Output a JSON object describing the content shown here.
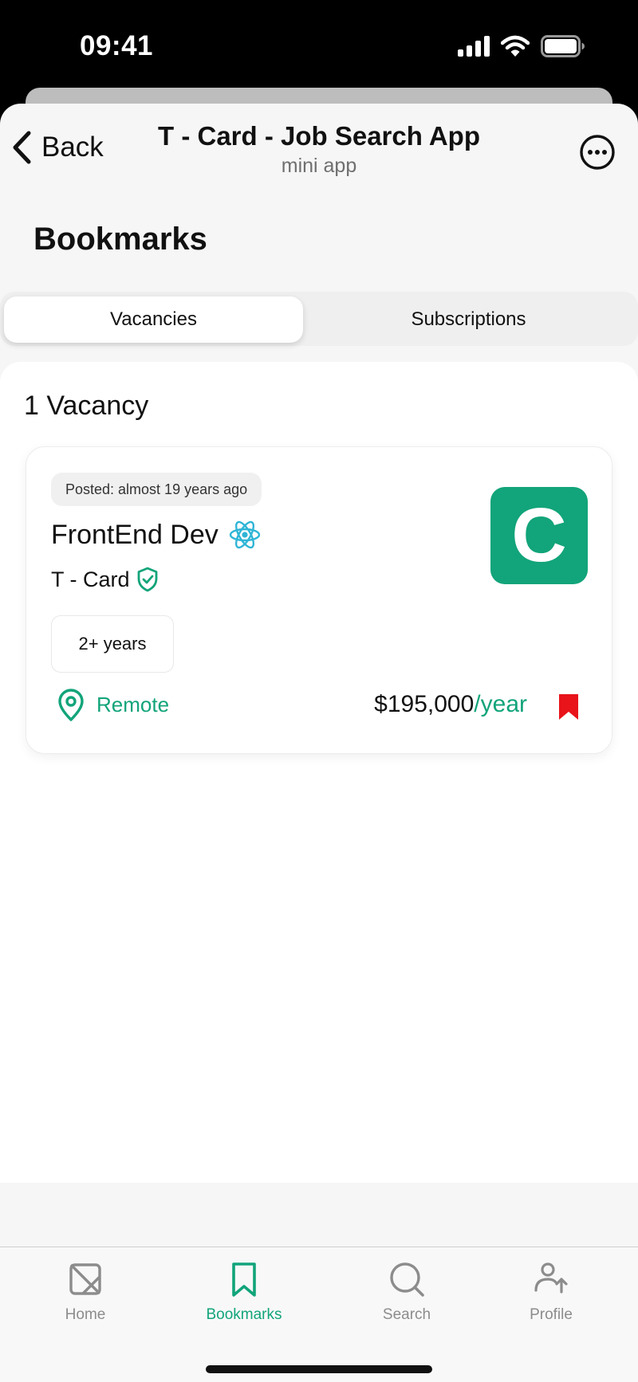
{
  "status": {
    "time": "09:41"
  },
  "nav": {
    "back_label": "Back",
    "title": "T - Card - Job Search App",
    "subtitle": "mini app"
  },
  "page": {
    "title": "Bookmarks"
  },
  "segments": {
    "vacancies": "Vacancies",
    "subscriptions": "Subscriptions",
    "active": "Vacancies"
  },
  "results": {
    "count_label": "1 Vacancy"
  },
  "job": {
    "posted": "Posted: almost 19 years ago",
    "title": "FrontEnd Dev",
    "company": "T - Card",
    "logo_letter": "C",
    "experience": "2+ years",
    "location": "Remote",
    "salary": "$195,000",
    "salary_period": "/year",
    "bookmarked": true
  },
  "tabs": [
    {
      "label": "Home",
      "icon": "home-icon",
      "active": false
    },
    {
      "label": "Bookmarks",
      "icon": "bookmark-icon",
      "active": true
    },
    {
      "label": "Search",
      "icon": "search-icon",
      "active": false
    },
    {
      "label": "Profile",
      "icon": "profile-icon",
      "active": false
    }
  ],
  "colors": {
    "accent": "#12a47a",
    "bookmark": "#e8141a",
    "react": "#2fb5d6"
  }
}
